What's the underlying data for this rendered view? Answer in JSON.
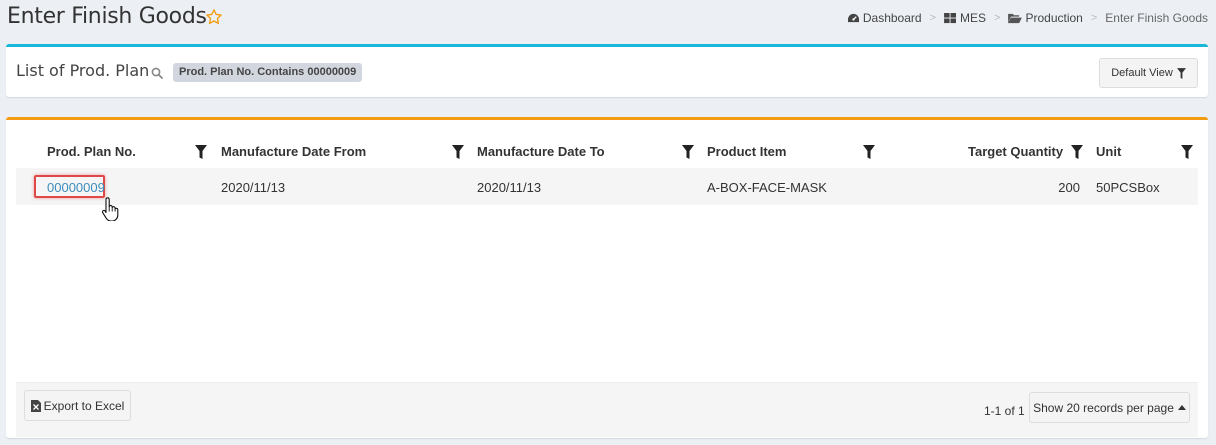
{
  "header": {
    "title": "Enter Finish Goods",
    "breadcrumb": [
      {
        "label": "Dashboard",
        "icon": "tachometer-icon"
      },
      {
        "label": "MES",
        "icon": "grid-icon"
      },
      {
        "label": "Production",
        "icon": "folder-open-icon"
      },
      {
        "label": "Enter Finish Goods",
        "icon": ""
      }
    ],
    "breadcrumb_separator": ">"
  },
  "filter_box": {
    "title": "List of Prod. Plan",
    "filter_tag": "Prod. Plan No. Contains 00000009",
    "default_view_label": "Default View",
    "accent": "#18b8d8"
  },
  "table": {
    "accent": "#f39c12",
    "columns": [
      "Prod. Plan No.",
      "Manufacture Date From",
      "Manufacture Date To",
      "Product Item",
      "Target Quantity",
      "Unit"
    ],
    "rows": [
      {
        "prod_plan_no": "00000009",
        "manufacture_date_from": "2020/11/13",
        "manufacture_date_to": "2020/11/13",
        "product_item": "A-BOX-FACE-MASK",
        "target_quantity": "200",
        "unit": "50PCSBox"
      }
    ]
  },
  "footer": {
    "export_label": "Export to Excel",
    "pagination": "1-1 of 1",
    "page_size_label": "Show 20 records per page"
  }
}
